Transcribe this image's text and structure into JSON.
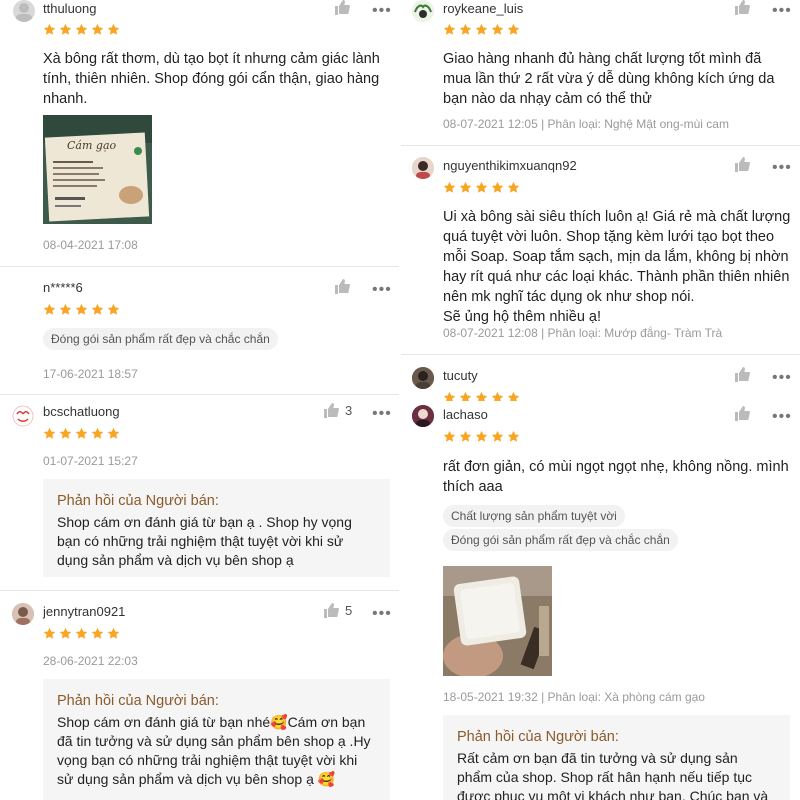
{
  "colors": {
    "star": "#f6a623",
    "reply_title": "#8a5a2b",
    "meta": "#9a9a9a"
  },
  "left_reviews": [
    {
      "username": "tthuluong",
      "stars": 5,
      "text": "Xà bông rất thơm, dù tạo bọt ít nhưng cảm giác lành tính, thiên nhiên. Shop đóng gói cẩn thận, giao hàng nhanh.",
      "photo_label": "Cám gạo",
      "date": "08-04-2021 17:08"
    },
    {
      "username": "n*****6",
      "stars": 5,
      "tags": [
        "Đóng gói sản phẩm rất đẹp và chắc chắn"
      ],
      "date": "17-06-2021 18:57"
    },
    {
      "username": "bcschatluong",
      "stars": 5,
      "likes": "3",
      "date": "01-07-2021 15:27",
      "reply_title": "Phản hồi của Người bán:",
      "reply_text": "Shop cám ơn đánh giá từ bạn ạ . Shop hy vọng bạn có những trải nghiệm thật tuyệt vời khi sử dụng sản phẩm và dịch vụ bên shop ạ"
    },
    {
      "username": "jennytran0921",
      "stars": 5,
      "likes": "5",
      "date": "28-06-2021 22:03",
      "reply_title": "Phản hồi của Người bán:",
      "reply_text": "Shop cám ơn đánh giá từ bạn nhé🥰Cám ơn bạn đã tin tưởng và sử dụng sản phẩm bên shop ạ .Hy vọng bạn có những trải nghiệm thật tuyệt vời khi sử dụng sản phẩm và dịch vụ bên shop ạ 🥰"
    }
  ],
  "right_reviews": [
    {
      "username": "roykeane_luis",
      "stars": 5,
      "text": "Giao hàng nhanh đủ hàng chất lượng tốt mình đã mua lần thứ 2 rất vừa ý dễ dùng không kích ứng da bạn nào da nhạy cảm có thể thử",
      "date": "08-07-2021 12:05 | Phân loại: Nghệ Mật ong-mùi cam"
    },
    {
      "username": "nguyenthikimxuanqn92",
      "stars": 5,
      "text": "Ui xà bông sài siêu thích luôn ạ! Giá rẻ mà chất lượng quá tuyệt vời luôn. Shop tặng kèm lưới tạo bọt theo mỗi Soap. Soap tắm sạch, mịn da lắm, không bị nhờn hay rít quá như các loại khác. Thành phần thiên nhiên nên mk nghĩ tác dụng ok như shop nói.\nSẽ ủng hộ thêm nhiều ạ!",
      "date": "08-07-2021 12:08 | Phân loại: Mướp đắng- Tràm Trà"
    },
    {
      "username": "tucuty",
      "stars": 5
    },
    {
      "username": "lachaso",
      "stars": 5,
      "text": "rất đơn giản, có mùi ngọt ngọt nhẹ, không nồng. mình thích aaa",
      "tags": [
        "Chất lượng sản phẩm tuyệt vời",
        "Đóng gói sản phẩm rất đẹp và chắc chắn"
      ],
      "date": "18-05-2021 19:32 | Phân loại: Xà phòng cám gạo",
      "reply_title": "Phản hồi của Người bán:",
      "reply_text": "Rất cảm ơn bạn đã tin tưởng và sử dụng sản phẩm của shop. Shop rất hân hạnh nếu tiếp tục được phục vụ một vị khách như bạn. Chúc bạn và"
    }
  ]
}
